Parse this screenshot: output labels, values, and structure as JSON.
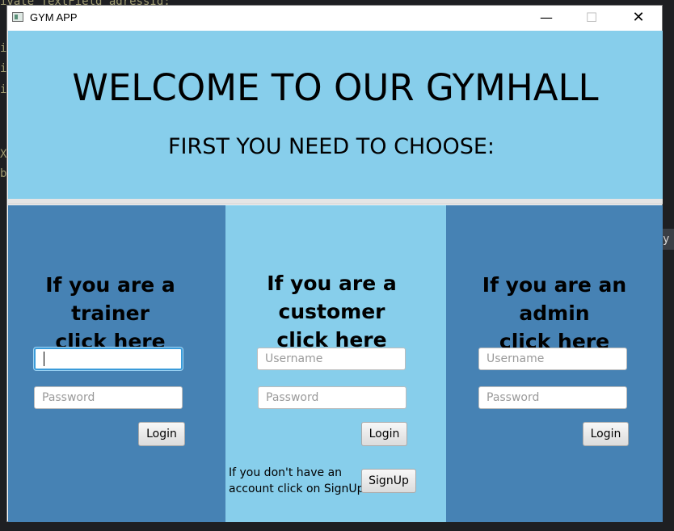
{
  "background_code": {
    "left_lines": [
      "i",
      "i",
      "i",
      "",
      "X",
      "b"
    ],
    "top_fragment": "ivate TextField adressId;",
    "right_fragment": "y"
  },
  "window": {
    "title": "GYM APP",
    "controls": {
      "minimize": "—",
      "maximize": "☐",
      "close": "✕"
    }
  },
  "header": {
    "welcome": "WELCOME TO OUR GYMHALL",
    "subtitle": "FIRST YOU NEED TO CHOOSE:"
  },
  "panels": {
    "trainer": {
      "heading_line1": "If you are a trainer",
      "heading_line2": "click here",
      "username_value": "",
      "password_placeholder": "Password",
      "login_label": "Login"
    },
    "customer": {
      "heading_line1": "If you are a customer",
      "heading_line2": "click here",
      "username_placeholder": "Username",
      "password_placeholder": "Password",
      "login_label": "Login",
      "signup_note_line1": "If you don't have an",
      "signup_note_line2": "account click on SignUp:",
      "signup_label": "SignUp"
    },
    "admin": {
      "heading_line1": "If you are an admin",
      "heading_line2": "click here",
      "username_placeholder": "Username",
      "password_placeholder": "Password",
      "login_label": "Login"
    }
  },
  "colors": {
    "light_blue": "#87ceeb",
    "steel_blue": "#4682b4",
    "focus_ring": "#3a9bd9"
  }
}
